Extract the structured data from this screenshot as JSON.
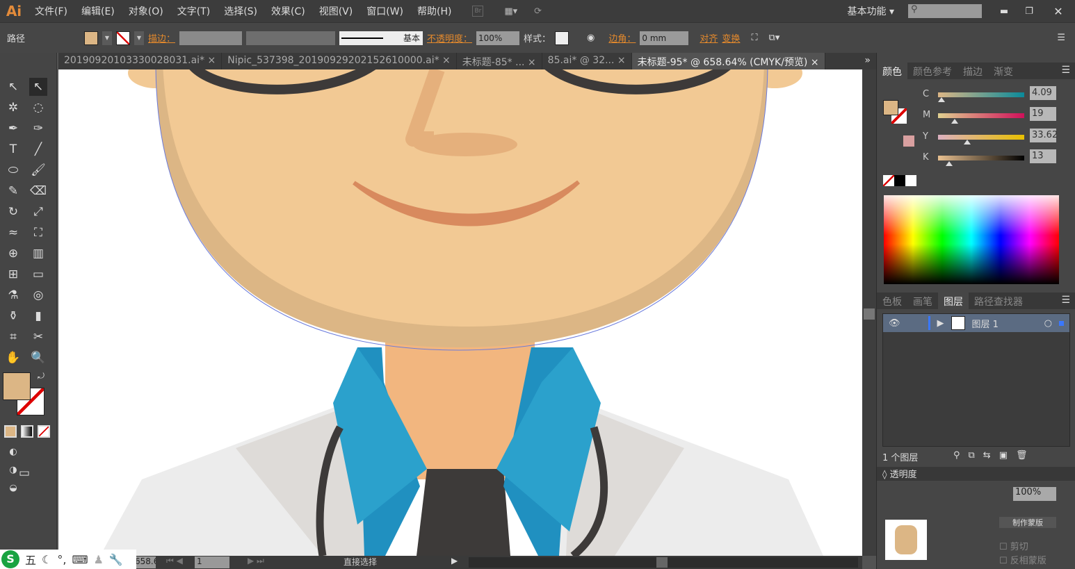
{
  "app": {
    "logo": "Ai",
    "menus": [
      "文件(F)",
      "编辑(E)",
      "对象(O)",
      "文字(T)",
      "选择(S)",
      "效果(C)",
      "视图(V)",
      "窗口(W)",
      "帮助(H)"
    ],
    "bridge": "Br",
    "workspace": "基本功能",
    "window_controls": [
      "minimize",
      "restore",
      "close"
    ]
  },
  "control": {
    "selection_type": "路径",
    "fill_color": "#dcb685",
    "stroke_label": "描边：",
    "stroke_style_label": "基本",
    "opacity_label": "不透明度：",
    "opacity_value": "100%",
    "style_label": "样式：",
    "corner_label": "边角：",
    "corner_value": "0 mm",
    "align_label": "对齐",
    "transform_label": "变换"
  },
  "tabs": [
    {
      "label": "20190920103330028031.ai*",
      "active": false
    },
    {
      "label": "Nipic_537398_20190929202152610000.ai*",
      "active": false
    },
    {
      "label": "未标题-85* ...",
      "active": false
    },
    {
      "label": "85.ai* @ 32...",
      "active": false
    },
    {
      "label": "未标题-95* @ 658.64% (CMYK/预览)",
      "active": true
    }
  ],
  "color_panel": {
    "tabs": [
      "颜色",
      "颜色参考",
      "描边",
      "渐变"
    ],
    "active": "颜色",
    "channels": [
      {
        "label": "C",
        "value": "4.09",
        "fraction": 0.04
      },
      {
        "label": "M",
        "value": "19",
        "fraction": 0.19
      },
      {
        "label": "Y",
        "value": "33.62",
        "fraction": 0.34
      },
      {
        "label": "K",
        "value": "13",
        "fraction": 0.13
      }
    ],
    "unit": "%",
    "fill_color": "#dcb685",
    "oog_color": "#d9a0a0"
  },
  "layers_panel": {
    "tabs": [
      "色板",
      "画笔",
      "图层",
      "路径查找器"
    ],
    "active": "图层",
    "layers": [
      {
        "name": "图层 1"
      }
    ],
    "count_label": "1 个图层"
  },
  "transparency_panel": {
    "title": "透明度",
    "opacity": "100%",
    "make_mask": "制作蒙版",
    "clip": "剪切",
    "invert_mask": "反相蒙版"
  },
  "status": {
    "zoom": "658.64",
    "page": "1",
    "tool": "直接选择"
  },
  "ime": {
    "mode": "五"
  },
  "colors": {
    "skin": "#f2c994",
    "skin_shadow": "#dcb685",
    "collar": "#2ba1cc",
    "collar_dark": "#2090c0",
    "dark": "#3d3a39",
    "neck": "#f2b67f"
  }
}
